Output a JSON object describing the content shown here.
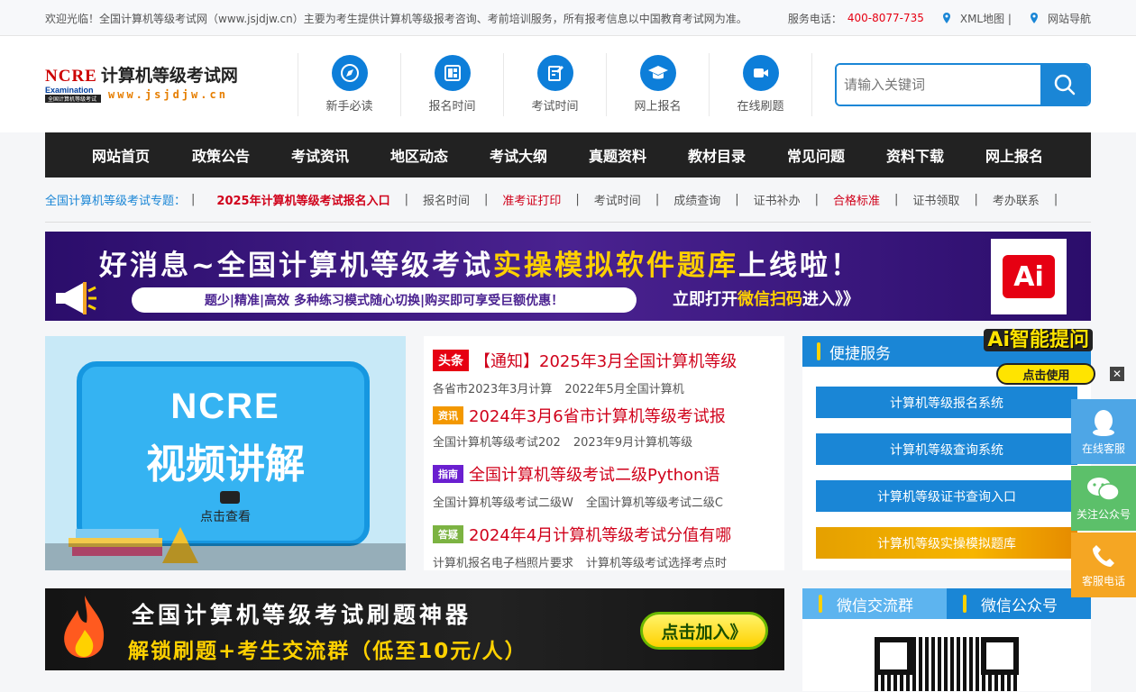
{
  "topbar": {
    "welcome": "欢迎光临！全国计算机等级考试网（www.jsjdjw.cn）主要为考生提供计算机等级报考咨询、考前培训服务，所有报考信息以中国教育考试网为准。",
    "phone_label": "服务电话：",
    "phone": "400-8077-735",
    "xml_map": "XML地图 |",
    "site_nav": "网站导航"
  },
  "logo": {
    "ncre": "NCRE",
    "exam": "Examination",
    "title": "计算机等级考试网",
    "url": "www.jsjdjw.cn",
    "tag": "全国计算机等级考试"
  },
  "quick": [
    {
      "label": "新手必读",
      "icon": "compass-icon"
    },
    {
      "label": "报名时间",
      "icon": "grid-icon"
    },
    {
      "label": "考试时间",
      "icon": "pen-icon"
    },
    {
      "label": "网上报名",
      "icon": "graduation-cap-icon"
    },
    {
      "label": "在线刷题",
      "icon": "video-camera-icon"
    }
  ],
  "search": {
    "placeholder": "请输入关键词"
  },
  "nav": [
    "网站首页",
    "政策公告",
    "考试资讯",
    "地区动态",
    "考试大纲",
    "真题资料",
    "教材目录",
    "常见问题",
    "资料下载",
    "网上报名"
  ],
  "topics": {
    "title": "全国计算机等级考试专题：",
    "links": [
      {
        "text": "2025年计算机等级考试报名入口",
        "style": "bold"
      },
      {
        "text": "报名时间",
        "style": ""
      },
      {
        "text": "准考证打印",
        "style": "hot"
      },
      {
        "text": "考试时间",
        "style": ""
      },
      {
        "text": "成绩查询",
        "style": ""
      },
      {
        "text": "证书补办",
        "style": ""
      },
      {
        "text": "合格标准",
        "style": "hot"
      },
      {
        "text": "证书领取",
        "style": ""
      },
      {
        "text": "考办联系",
        "style": ""
      }
    ]
  },
  "banner1": {
    "main_a": "好消息~全国计算机等级考试",
    "main_b": "实操模拟软件题库",
    "main_c": "上线啦！",
    "strip": "题少|精准|高效  多种练习模式随心切换|购买即可享受巨额优惠！",
    "open_a": "立即打开",
    "open_b": "微信扫码",
    "open_c": "进入》》",
    "ai": "Ai",
    "close": "✕"
  },
  "video": {
    "t1": "NCRE",
    "t2": "视频讲解",
    "t3": "点击查看"
  },
  "news": [
    {
      "tag": "头条",
      "tag_color": "red",
      "title": "【通知】2025年3月全国计算机等级",
      "subs": [
        "各省市2023年3月计算",
        "2022年5月全国计算机"
      ]
    },
    {
      "tag": "资讯",
      "tag_color": "orange",
      "title": "2024年3月6省市计算机等级考试报",
      "subs": [
        "全国计算机等级考试202",
        "2023年9月计算机等级"
      ]
    },
    {
      "tag": "指南",
      "tag_color": "purple",
      "title": "全国计算机等级考试二级Python语",
      "subs": [
        "全国计算机等级考试二级W",
        "全国计算机等级考试二级C"
      ]
    },
    {
      "tag": "答疑",
      "tag_color": "green",
      "title": "2024年4月计算机等级考试分值有哪",
      "subs": [
        "计算机报名电子档照片要求",
        "计算机等级考试选择考点时"
      ]
    }
  ],
  "service": {
    "title": "便捷服务",
    "ai_label": "Ai智能提问",
    "ai_use": "点击使用",
    "buttons": [
      "计算机等级报名系统",
      "计算机等级查询系统",
      "计算机等级证书查询入口",
      "计算机等级实操模拟题库"
    ]
  },
  "banner2": {
    "line1": "全国计算机等级考试刷题神器",
    "line2": "解锁刷题+考生交流群（低至10元/人）",
    "join": "点击加入》"
  },
  "wx": {
    "tab1": "微信交流群",
    "tab2": "微信公众号"
  },
  "float": [
    {
      "label": "在线客服",
      "icon": "qq-penguin-icon",
      "color": "#4ea6e6"
    },
    {
      "label": "关注公众号",
      "icon": "wechat-icon",
      "color": "#5cc06a"
    },
    {
      "label": "客服电话",
      "icon": "phone-icon",
      "color": "#f5a623"
    }
  ],
  "colors": {
    "brand": "#1a86d6",
    "nav": "#222222",
    "hot": "#d0021b",
    "accent": "#ffd100"
  }
}
